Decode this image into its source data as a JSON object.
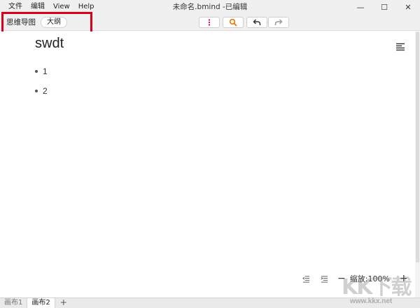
{
  "window": {
    "title": "未命名.bmind -已编辑",
    "minimize_glyph": "—",
    "maximize_glyph": "☐",
    "close_glyph": "✕"
  },
  "menu": {
    "items": [
      "文件",
      "编辑",
      "View",
      "Help"
    ]
  },
  "toolbar": {
    "mode_label": "思维导图",
    "outline_label": "大纲",
    "buttons": [
      {
        "icon": "more-vertical-icon",
        "color": "#d9001b"
      },
      {
        "icon": "search-icon",
        "color": "#e07b00"
      },
      {
        "icon": "undo-icon",
        "color": "#333333"
      },
      {
        "icon": "redo-icon",
        "color": "#999999"
      }
    ]
  },
  "document": {
    "title": "swdt",
    "items": [
      "1",
      "2"
    ]
  },
  "zoom": {
    "minus": "−",
    "label": "缩放:100%",
    "plus": "+"
  },
  "tabs": {
    "items": [
      "画布1",
      "画布2"
    ],
    "active_index": 1,
    "add_label": "+"
  },
  "watermark": {
    "text": "KK下载",
    "url": "www.kkx.net"
  },
  "colors": {
    "highlight": "#d9001b",
    "toolbar_bg": "#f0f0f0"
  }
}
